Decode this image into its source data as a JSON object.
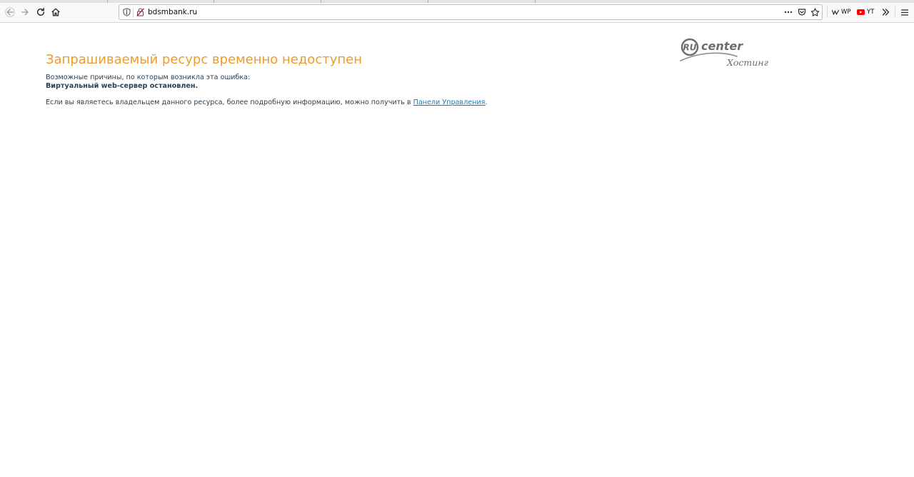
{
  "browser": {
    "url": "bdsmbank.ru",
    "bookmarks": [
      {
        "icon": "wikipedia-icon",
        "label": "WP"
      },
      {
        "icon": "youtube-icon",
        "label": "YT"
      }
    ]
  },
  "page": {
    "headline": "Запрашиваемый ресурс временно недоступен",
    "reasons_label": "Возможные причины, по которым возникла эта ошибка:",
    "reason": "Виртуальный web-сервер остановлен.",
    "owner_text_before": "Если вы являетесь владельцем данного ресурса, более подробную информацию, можно получить в ",
    "owner_link": "Панели Управления",
    "owner_text_after": "."
  },
  "logo": {
    "badge": "RU",
    "word": "center",
    "subtitle": "Хостинг"
  },
  "colors": {
    "headline": "#ef9b2a",
    "body_text": "#2c3f4e",
    "link": "#1b7bb0",
    "logo": "#6d6d6d"
  }
}
